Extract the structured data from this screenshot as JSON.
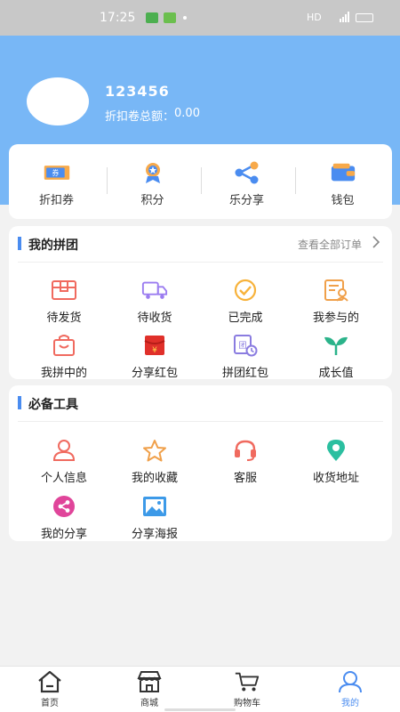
{
  "status_bar": {
    "time": "17:25",
    "network": "HD"
  },
  "profile": {
    "username": "123456",
    "coupon_total_label": "折扣卷总额：",
    "coupon_total_value": "0.00"
  },
  "quick_links": [
    {
      "label": "折扣券",
      "icon": "coupon-icon"
    },
    {
      "label": "积分",
      "icon": "points-icon"
    },
    {
      "label": "乐分享",
      "icon": "share-icon"
    },
    {
      "label": "钱包",
      "icon": "wallet-icon"
    }
  ],
  "group_section": {
    "title": "我的拼团",
    "view_all": "查看全部订单",
    "items": [
      {
        "label": "待发货",
        "icon": "pending-ship-icon"
      },
      {
        "label": "待收货",
        "icon": "delivery-truck-icon"
      },
      {
        "label": "已完成",
        "icon": "completed-icon"
      },
      {
        "label": "我参与的",
        "icon": "participated-icon"
      },
      {
        "label": "我拼中的",
        "icon": "shopping-bag-icon"
      },
      {
        "label": "分享红包",
        "icon": "red-envelope-icon"
      },
      {
        "label": "拼团红包",
        "icon": "group-envelope-icon"
      },
      {
        "label": "成长值",
        "icon": "sprout-icon"
      }
    ]
  },
  "tools_section": {
    "title": "必备工具",
    "items": [
      {
        "label": "个人信息",
        "icon": "person-icon"
      },
      {
        "label": "我的收藏",
        "icon": "star-icon"
      },
      {
        "label": "客服",
        "icon": "headset-icon"
      },
      {
        "label": "收货地址",
        "icon": "location-icon"
      },
      {
        "label": "我的分享",
        "icon": "share-circle-icon"
      },
      {
        "label": "分享海报",
        "icon": "poster-icon"
      }
    ]
  },
  "bottom_nav": [
    {
      "label": "首页",
      "icon": "home-icon"
    },
    {
      "label": "商城",
      "icon": "store-icon"
    },
    {
      "label": "购物车",
      "icon": "cart-icon"
    },
    {
      "label": "我的",
      "icon": "user-icon",
      "active": true
    }
  ],
  "colors": {
    "header": "#78b7f6",
    "accent": "#4a8cf0",
    "nav_active": "#4a8cf0"
  }
}
